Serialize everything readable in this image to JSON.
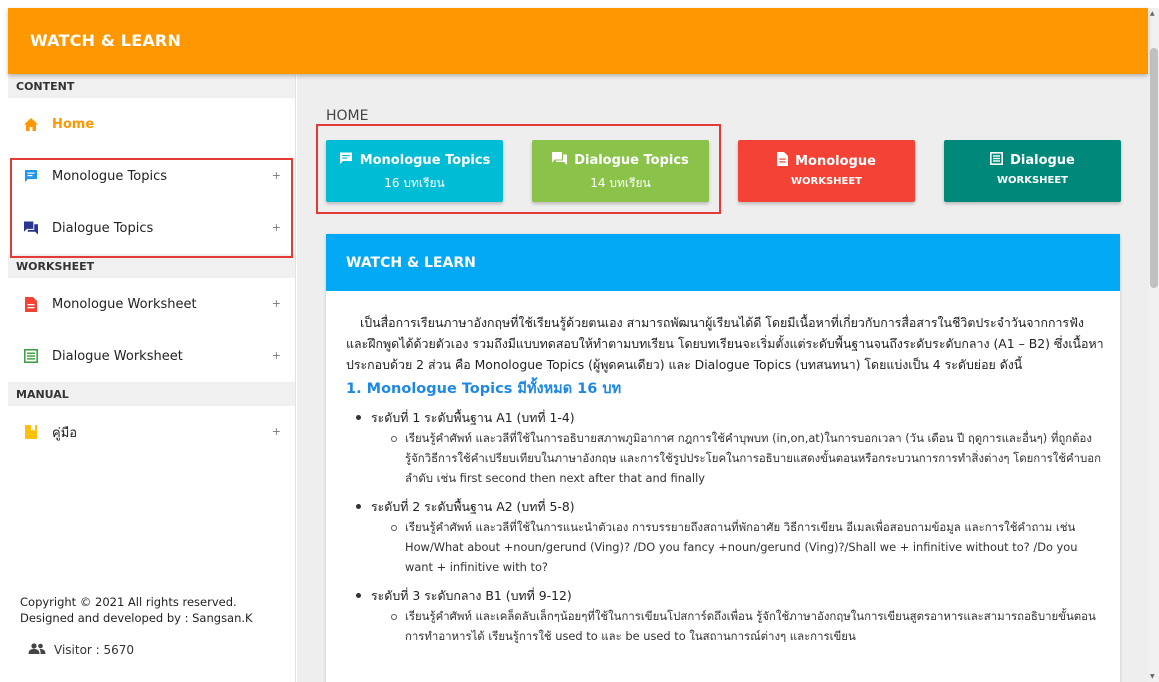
{
  "header": {
    "brand": "WATCH & LEARN"
  },
  "sidebar": {
    "sections": [
      {
        "title": "CONTENT"
      },
      {
        "title": "WORKSHEET"
      },
      {
        "title": "MANUAL"
      }
    ],
    "items": [
      {
        "label": "Home",
        "icon": "home-icon",
        "color": "#ff9800"
      },
      {
        "label": "Monologue Topics",
        "icon": "monologue-chat-icon",
        "color": "#2196f3"
      },
      {
        "label": "Dialogue Topics",
        "icon": "dialogue-chat-icon",
        "color": "#283593"
      },
      {
        "label": "Monologue Worksheet",
        "icon": "document-icon",
        "color": "#f44336"
      },
      {
        "label": "Dialogue Worksheet",
        "icon": "list-document-icon",
        "color": "#43a047"
      },
      {
        "label": "คู่มือ",
        "icon": "bookmark-icon",
        "color": "#ffc107"
      }
    ],
    "plus": "+",
    "footer": {
      "copyright": "Copyright © 2021 All rights reserved.",
      "credit": "Designed and developed by : Sangsan.K",
      "visitor": "Visitor : 5670"
    }
  },
  "main": {
    "page_title": "HOME",
    "tiles": [
      {
        "title": "Monologue Topics",
        "sub": "16 บทเรียน",
        "color": "#00bcd4"
      },
      {
        "title": "Dialogue Topics",
        "sub": "14 บทเรียน",
        "color": "#8bc34a"
      },
      {
        "title": "Monologue",
        "sub": "WORKSHEET",
        "color": "#f44336"
      },
      {
        "title": "Dialogue",
        "sub": "WORKSHEET",
        "color": "#00897b"
      }
    ],
    "card": {
      "title": "WATCH & LEARN",
      "intro": "เป็นสื่อการเรียนภาษาอังกฤษที่ใช้เรียนรู้ด้วยตนเอง สามารถพัฒนาผู้เรียนได้ดี โดยมีเนื้อหาที่เกี่ยวกับการสื่อสารในชีวิตประจำวันจากการฟัง และฝึกพูดได้ด้วยตัวเอง รวมถึงมีแบบทดสอบให้ทำตามบทเรียน โดยบทเรียนจะเริ่มตั้งแต่ระดับพื้นฐานจนถึงระดับระดับกลาง (A1 – B2) ซึ่งเนื้อหาประกอบด้วย 2 ส่วน คือ Monologue Topics (ผู้พูดคนเดียว) และ Dialogue Topics (บทสนทนา) โดยแบ่งเป็น 4 ระดับย่อย ดังนี้",
      "heading": "1. Monologue Topics มีทั้งหมด 16 บท",
      "levels": [
        {
          "title": "ระดับที่ 1 ระดับพื้นฐาน A1 (บทที่ 1-4)",
          "detail": "เรียนรู้คำศัพท์ และวลีที่ใช้ในการอธิบายสภาพภูมิอากาศ กฎการใช้คำบุพบท (in,on,at)ในการบอกเวลา (วัน เดือน ปี ฤดูการและอื่นๆ) ที่ถูกต้อง รู้จักวิธีการใช้คำเปรียบเทียบในภาษาอังกฤษ และการใช้รูปประโยคในการอธิบายแสดงขั้นตอนหรือกระบวนการการทำสิ่งต่างๆ โดยการใช้คำบอกลำดับ เช่น first second then next after that and finally"
        },
        {
          "title": "ระดับที่ 2 ระดับพื้นฐาน A2 (บทที่ 5-8)",
          "detail": "เรียนรู้คำศัพท์ และวลีที่ใช้ในการแนะนำตัวเอง การบรรยายถึงสถานที่พักอาศัย วิธีการเขียน อีเมลเพื่อสอบถามข้อมูล และการใช้คำถาม เช่น How/What about +noun/gerund (Ving)? /DO you fancy +noun/gerund (Ving)?/Shall we + infinitive without to? /Do you want + infinitive with to?"
        },
        {
          "title": "ระดับที่ 3 ระดับกลาง B1 (บทที่ 9-12)",
          "detail": "เรียนรู้คำศัพท์ และเคล็ดลับเล็กๆน้อยๆที่ใช้ในการเขียนโปสการ์ดถึงเพื่อน รู้จักใช้ภาษาอังกฤษในการเขียนสูตรอาหารและสามารถอธิบายขั้นตอนการทำอาหารได้ เรียนรู้การใช้ used to และ be used to ในสถานการณ์ต่างๆ และการเขียน"
        }
      ]
    }
  }
}
